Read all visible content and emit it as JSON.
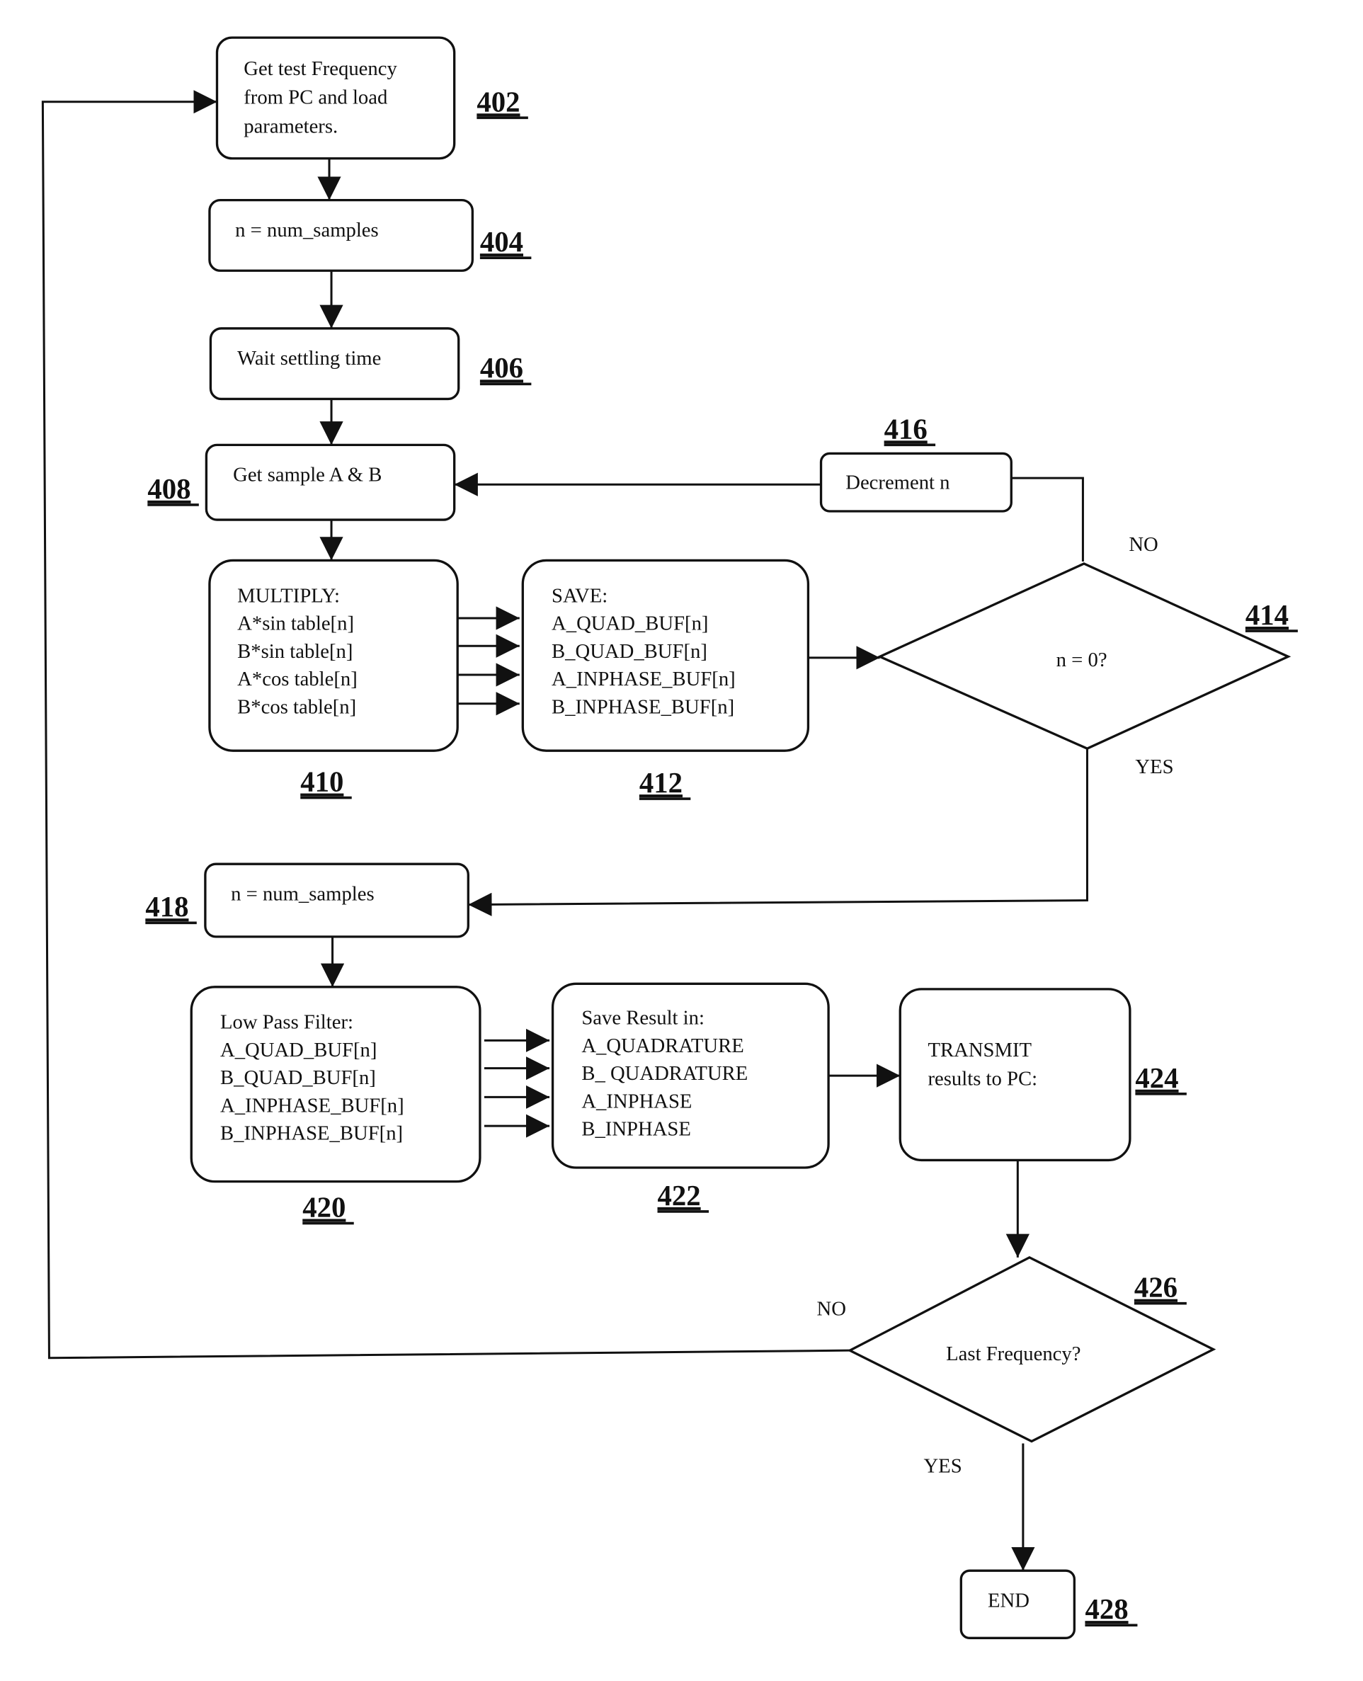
{
  "diagram": {
    "type": "flowchart",
    "nodes": {
      "n402": {
        "ref": "402",
        "lines": [
          "Get test Frequency",
          "from  PC and load",
          "parameters."
        ]
      },
      "n404": {
        "ref": "404",
        "lines": [
          "n = num_samples"
        ]
      },
      "n406": {
        "ref": "406",
        "lines": [
          "Wait settling time"
        ]
      },
      "n408": {
        "ref": "408",
        "lines": [
          "Get sample A & B"
        ]
      },
      "n410": {
        "ref": "410",
        "lines": [
          "MULTIPLY:",
          "A*sin table[n]",
          "B*sin table[n]",
          "A*cos table[n]",
          "B*cos table[n]"
        ]
      },
      "n412": {
        "ref": "412",
        "lines": [
          "SAVE:",
          "A_QUAD_BUF[n]",
          "B_QUAD_BUF[n]",
          "A_INPHASE_BUF[n]",
          "B_INPHASE_BUF[n]"
        ]
      },
      "n414": {
        "ref": "414",
        "lines": [
          "n = 0?"
        ],
        "no_label": "NO",
        "yes_label": "YES"
      },
      "n416": {
        "ref": "416",
        "lines": [
          "Decrement n"
        ]
      },
      "n418": {
        "ref": "418",
        "lines": [
          "n = num_samples"
        ]
      },
      "n420": {
        "ref": "420",
        "lines": [
          "Low Pass Filter:",
          "A_QUAD_BUF[n]",
          "B_QUAD_BUF[n]",
          "A_INPHASE_BUF[n]",
          "B_INPHASE_BUF[n]"
        ]
      },
      "n422": {
        "ref": "422",
        "lines": [
          "Save Result in:",
          "A_QUADRATURE",
          "B_ QUADRATURE",
          "A_INPHASE",
          "B_INPHASE"
        ]
      },
      "n424": {
        "ref": "424",
        "lines": [
          "TRANSMIT",
          "results to PC:"
        ]
      },
      "n426": {
        "ref": "426",
        "lines": [
          "Last Frequency?"
        ],
        "no_label": "NO",
        "yes_label": "YES"
      },
      "n428": {
        "ref": "428",
        "lines": [
          "END"
        ]
      }
    },
    "edges": [
      {
        "from": "402",
        "to": "404"
      },
      {
        "from": "404",
        "to": "406"
      },
      {
        "from": "406",
        "to": "408"
      },
      {
        "from": "408",
        "to": "410"
      },
      {
        "from": "410",
        "to": "412",
        "count": 4
      },
      {
        "from": "412",
        "to": "414"
      },
      {
        "from": "414",
        "to": "416",
        "label": "NO"
      },
      {
        "from": "416",
        "to": "408"
      },
      {
        "from": "414",
        "to": "418",
        "label": "YES"
      },
      {
        "from": "418",
        "to": "420"
      },
      {
        "from": "420",
        "to": "422",
        "count": 4
      },
      {
        "from": "422",
        "to": "424"
      },
      {
        "from": "424",
        "to": "426"
      },
      {
        "from": "426",
        "to": "402",
        "label": "NO"
      },
      {
        "from": "426",
        "to": "428",
        "label": "YES"
      }
    ]
  }
}
